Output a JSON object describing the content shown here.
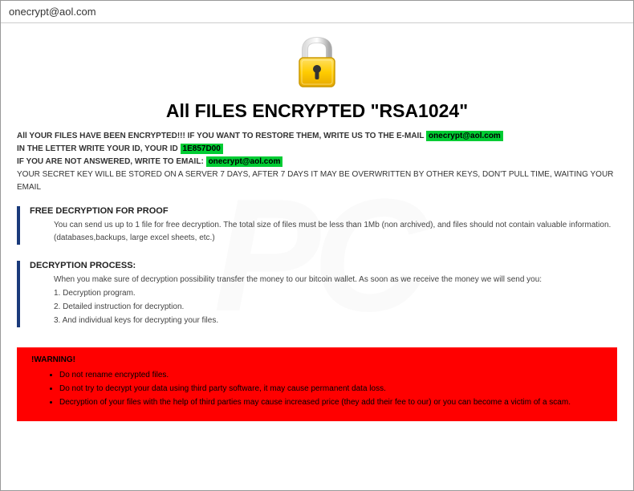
{
  "window": {
    "title": "onecrypt@aol.com"
  },
  "main_heading": "All FILES ENCRYPTED \"RSA1024\"",
  "intro": {
    "line1_prefix": "All YOUR FILES HAVE BEEN ENCRYPTED!!! IF YOU WANT TO RESTORE THEM, WRITE US TO THE E-MAIL ",
    "email1": "onecrypt@aol.com",
    "line2_prefix": "IN THE LETTER WRITE YOUR ID, YOUR ID ",
    "id_value": "1E857D00",
    "line3_prefix": "IF YOU ARE NOT ANSWERED, WRITE TO EMAIL: ",
    "email2": "onecrypt@aol.com",
    "line4": "YOUR SECRET KEY WILL BE STORED ON A SERVER 7 DAYS, AFTER 7 DAYS IT MAY BE OVERWRITTEN BY OTHER KEYS, DON'T PULL TIME, WAITING YOUR EMAIL"
  },
  "free_decrypt": {
    "title": "FREE DECRYPTION FOR PROOF",
    "body": "You can send us up to 1 file for free decryption. The total size of files must be less than 1Mb (non archived), and files should not contain valuable information. (databases,backups, large excel sheets, etc.)"
  },
  "process": {
    "title": "DECRYPTION PROCESS:",
    "intro": "When you make sure of decryption possibility transfer the money to our bitcoin wallet. As soon as we receive the money we will send you:",
    "step1": "1. Decryption program.",
    "step2": "2. Detailed instruction for decryption.",
    "step3": "3. And individual keys for decrypting your files."
  },
  "warning": {
    "title": "!WARNING!",
    "item1": "Do not rename encrypted files.",
    "item2": "Do not try to decrypt your data using third party software, it may cause permanent data loss.",
    "item3": "Decryption of your files with the help of third parties may cause increased price (they add their fee to our) or you can become a victim of a scam."
  }
}
